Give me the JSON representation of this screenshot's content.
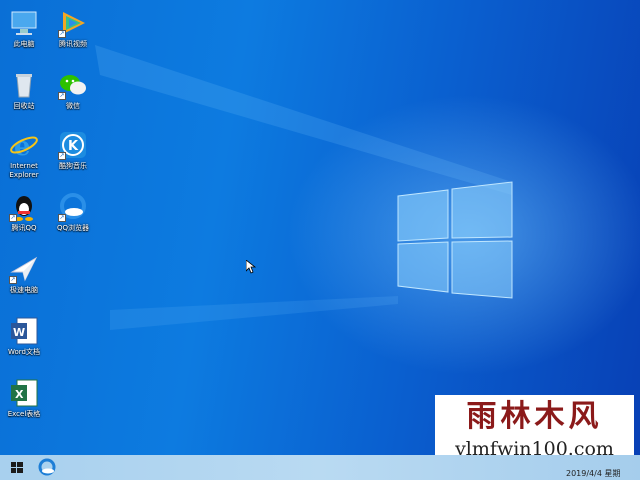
{
  "desktop": {
    "icons": [
      {
        "label": "此电脑",
        "icon": "computer-icon"
      },
      {
        "label": "腾讯视频",
        "icon": "tencent-video-icon"
      },
      {
        "label": "回收站",
        "icon": "recycle-bin-icon"
      },
      {
        "label": "微信",
        "icon": "wechat-icon"
      },
      {
        "label": "Internet\nExplorer",
        "icon": "internet-explorer-icon"
      },
      {
        "label": "酷狗音乐",
        "icon": "kugou-music-icon"
      },
      {
        "label": "腾讯QQ",
        "icon": "qq-penguin-icon"
      },
      {
        "label": "QQ浏览器",
        "icon": "qq-browser-icon"
      },
      {
        "label": "极速电脑",
        "icon": "speed-pc-icon"
      },
      {
        "label": "Word文档",
        "icon": "word-icon"
      },
      {
        "label": "Excel表格",
        "icon": "excel-icon"
      }
    ]
  },
  "watermark": {
    "title": "雨林木风",
    "url": "ylmfwin100.com"
  },
  "taskbar": {
    "start_icon": "windows-start-icon",
    "pinned": [
      "qq-browser-icon"
    ],
    "clock_text": "2019/4/4 星期"
  },
  "colors": {
    "desktop": "#0a6fd6",
    "taskbar": "#b4d7f0",
    "word": "#2b579a",
    "excel": "#217346"
  }
}
